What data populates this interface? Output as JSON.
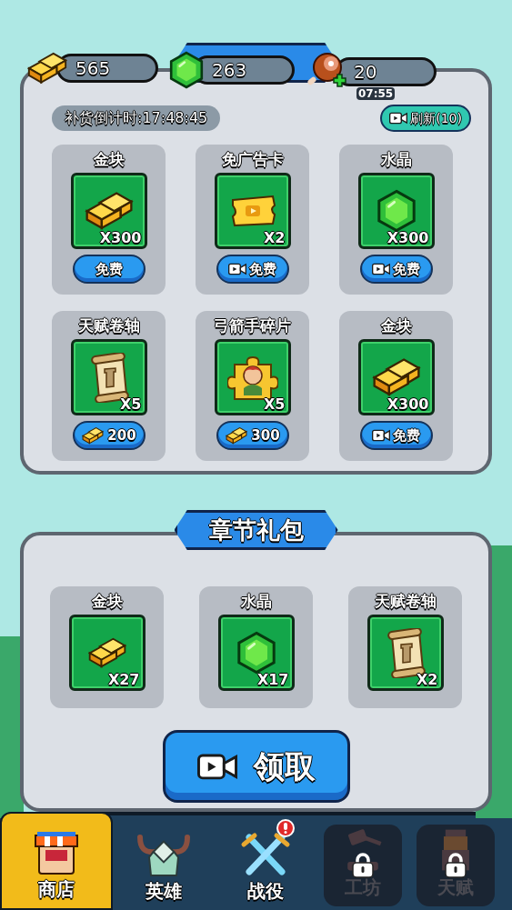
{
  "resources": [
    {
      "kind": "gold",
      "value": "565"
    },
    {
      "kind": "gem",
      "value": "263"
    },
    {
      "kind": "meat",
      "value": "20",
      "timer": "07:55"
    }
  ],
  "daily_shop": {
    "restock": "补货倒计时:17:48:45",
    "refresh": "刷新(10)",
    "items": [
      {
        "name": "金块",
        "kind": "gold",
        "qty": "X300",
        "price": {
          "kind": "plain",
          "label": "免费"
        }
      },
      {
        "name": "免广告卡",
        "kind": "ticket",
        "qty": "X2",
        "price": {
          "kind": "video",
          "label": "免费"
        }
      },
      {
        "name": "水晶",
        "kind": "gem",
        "qty": "X300",
        "price": {
          "kind": "video",
          "label": "免费"
        }
      },
      {
        "name": "天赋卷轴",
        "kind": "scroll",
        "qty": "X5",
        "price": {
          "kind": "gold",
          "label": "200"
        }
      },
      {
        "name": "弓箭手碎片",
        "kind": "puzzle",
        "qty": "X5",
        "price": {
          "kind": "gold",
          "label": "300"
        }
      },
      {
        "name": "金块",
        "kind": "gold",
        "qty": "X300",
        "price": {
          "kind": "video",
          "label": "免费"
        }
      }
    ]
  },
  "chapter_pack": {
    "title": "章节礼包",
    "items": [
      {
        "name": "金块",
        "kind": "gold",
        "qty": "X27"
      },
      {
        "name": "水晶",
        "kind": "gem",
        "qty": "X17"
      },
      {
        "name": "天赋卷轴",
        "kind": "scroll",
        "qty": "X2"
      }
    ],
    "claim": "领取"
  },
  "nav": [
    {
      "kind": "shop",
      "label": "商店",
      "selected": true,
      "locked": false,
      "alert": false
    },
    {
      "kind": "helmet",
      "label": "英雄",
      "selected": false,
      "locked": false,
      "alert": false
    },
    {
      "kind": "swords",
      "label": "战役",
      "selected": false,
      "locked": false,
      "alert": true
    },
    {
      "kind": "hammer",
      "label": "工坊",
      "selected": false,
      "locked": true,
      "alert": false
    },
    {
      "kind": "tower",
      "label": "天赋",
      "selected": false,
      "locked": true,
      "alert": false
    }
  ]
}
